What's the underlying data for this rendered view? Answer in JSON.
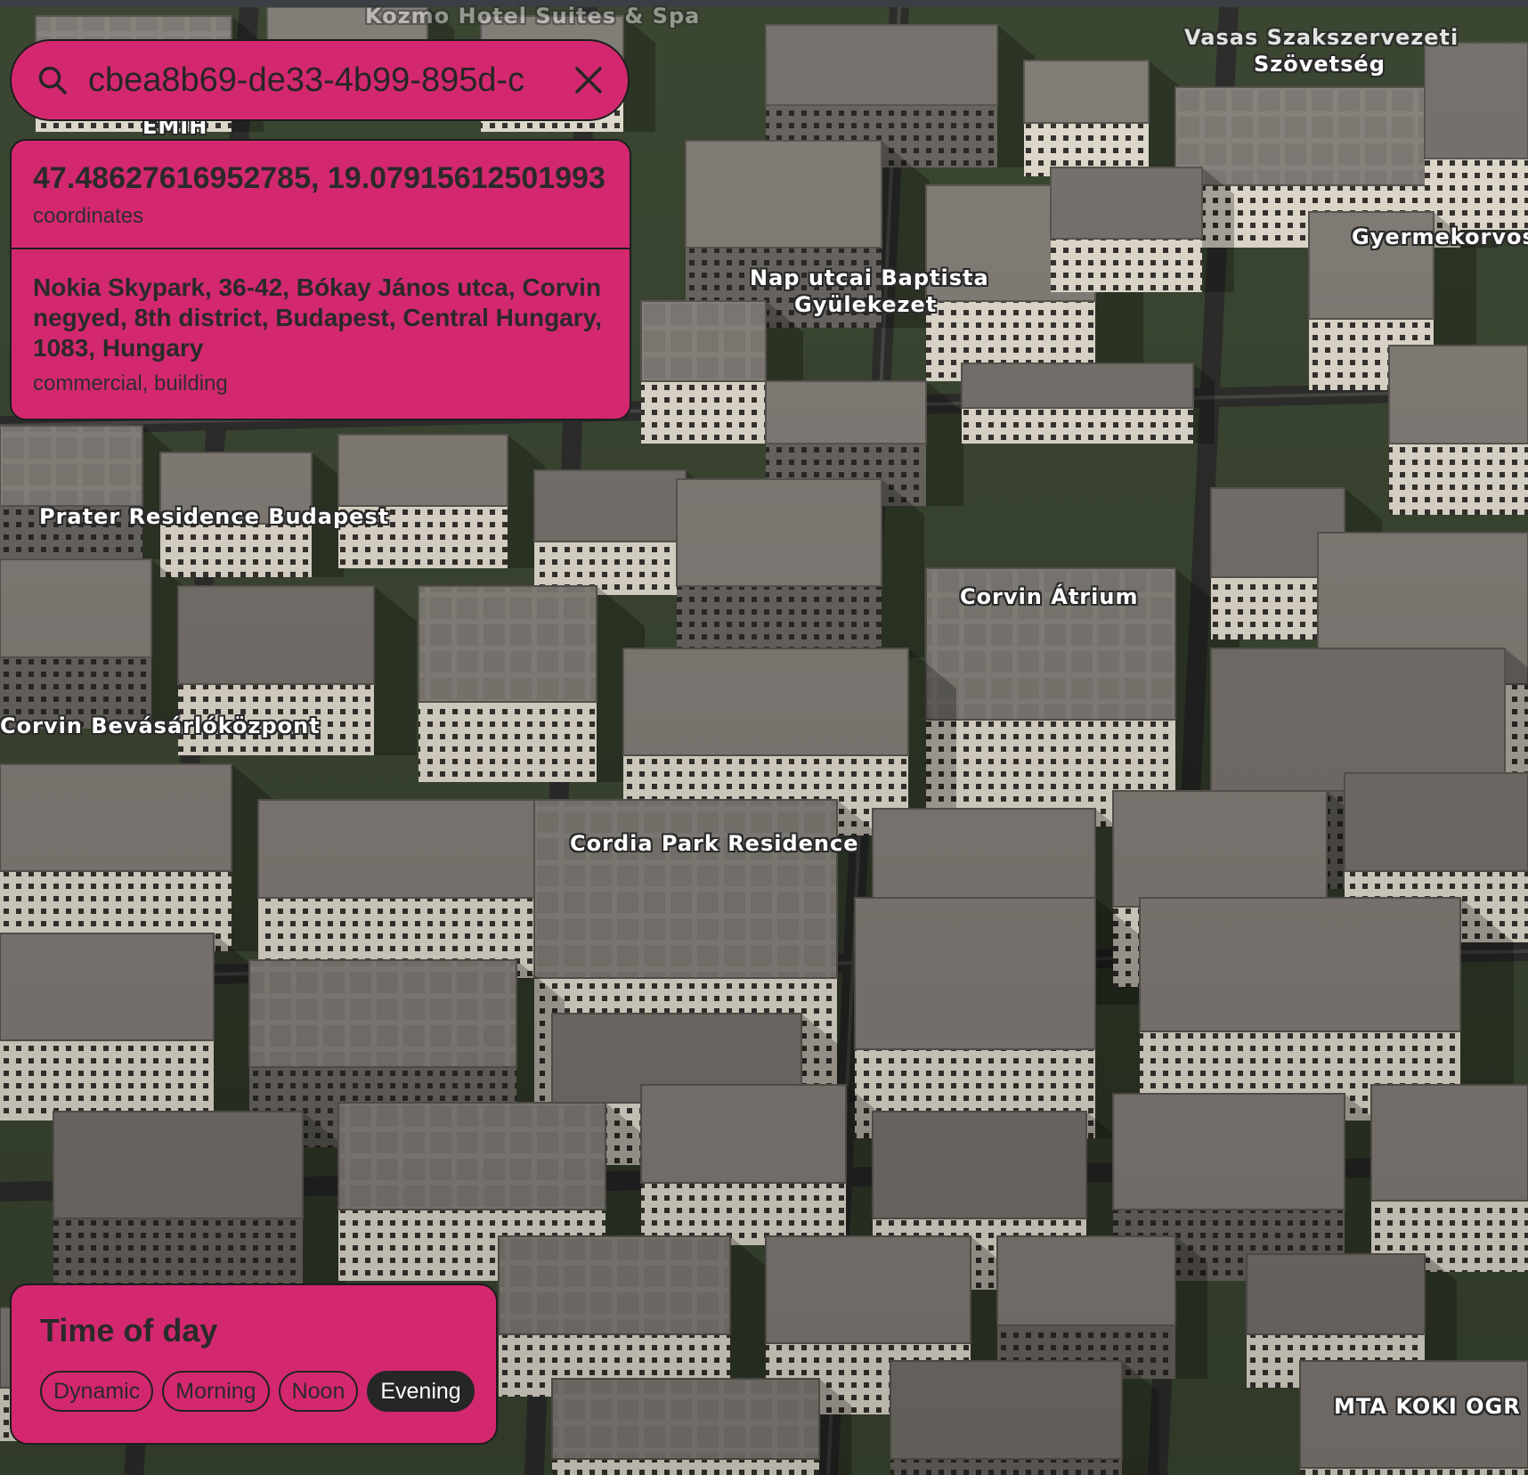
{
  "search": {
    "value": "cbea8b69-de33-4b99-895d-c",
    "icon": "search-icon",
    "clear_icon": "close-icon"
  },
  "info": {
    "coordinates": "47.48627616952785, 19.07915612501993",
    "coordinates_label": "coordinates",
    "address": "Nokia Skypark, 36-42, Bókay János utca, Corvin negyed, 8th district, Budapest, Central Hungary, 1083, Hungary",
    "address_label": "commercial, building"
  },
  "time_of_day": {
    "title": "Time of day",
    "options": [
      "Dynamic",
      "Morning",
      "Noon",
      "Evening"
    ],
    "selected": "Evening"
  },
  "map": {
    "labels": [
      "Kozmo Hotel Suites & Spa",
      "Vasas Szakszervezeti",
      "Szövetség",
      "EMIH",
      "Gyermekorvosi",
      "Nap utcai Baptista",
      "Gyülekezet",
      "Prater Residence Budapest",
      "Corvin Átrium",
      "Corvin Bevásárlóközpont",
      "Cordia Park Residence",
      "MTA KOKI OGR"
    ]
  },
  "colors": {
    "panel": "#d3286f",
    "panel_border": "#1d1d1d",
    "chip_active": "#262626",
    "ground": "#3c4a32",
    "building_top": "#8c8680",
    "building_wall": "#e9e3d6"
  }
}
